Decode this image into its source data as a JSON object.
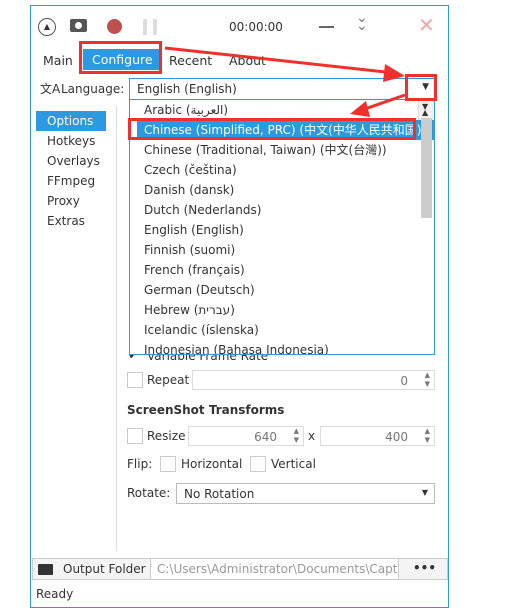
{
  "titlebar": {
    "time": "00:00:00",
    "icons": [
      "collapse-icon",
      "camera-icon",
      "record-icon",
      "pause-icon",
      "minimize-icon",
      "double-chevron-down-icon",
      "close-icon"
    ]
  },
  "tabs": [
    "Main",
    "Configure",
    "Recent",
    "About"
  ],
  "language": {
    "label": "Language:",
    "value": "English (English)",
    "options": [
      "Arabic (العربية)",
      "Chinese (Simplified, PRC) (中文(中华人民共和国))",
      "Chinese (Traditional, Taiwan) (中文(台灣))",
      "Czech (čeština)",
      "Danish (dansk)",
      "Dutch (Nederlands)",
      "English (English)",
      "Finnish (suomi)",
      "French (français)",
      "German (Deutsch)",
      "Hebrew (עברית)",
      "Icelandic (íslenska)",
      "Indonesian (Bahasa Indonesia)"
    ],
    "selected": "Chinese (Simplified, PRC) (中文(中华人民共和国))"
  },
  "sidebar": [
    "Options",
    "Hotkeys",
    "Overlays",
    "FFmpeg",
    "Proxy",
    "Extras"
  ],
  "gif": {
    "variable_frame_rate": "Variable Frame Rate",
    "repeat": "Repeat",
    "repeat_value": "0"
  },
  "transforms": {
    "title": "ScreenShot Transforms",
    "resize": "Resize",
    "width": "640",
    "x": "x",
    "height": "400",
    "flip": "Flip:",
    "horizontal": "Horizontal",
    "vertical": "Vertical",
    "rotate": "Rotate:",
    "rotate_value": "No Rotation"
  },
  "output": {
    "label": "Output Folder",
    "path": "C:\\Users\\Administrator\\Documents\\Captu",
    "more": "•••"
  },
  "status": "Ready",
  "accent": "#2b9ae0",
  "annotation": "#f0302a"
}
